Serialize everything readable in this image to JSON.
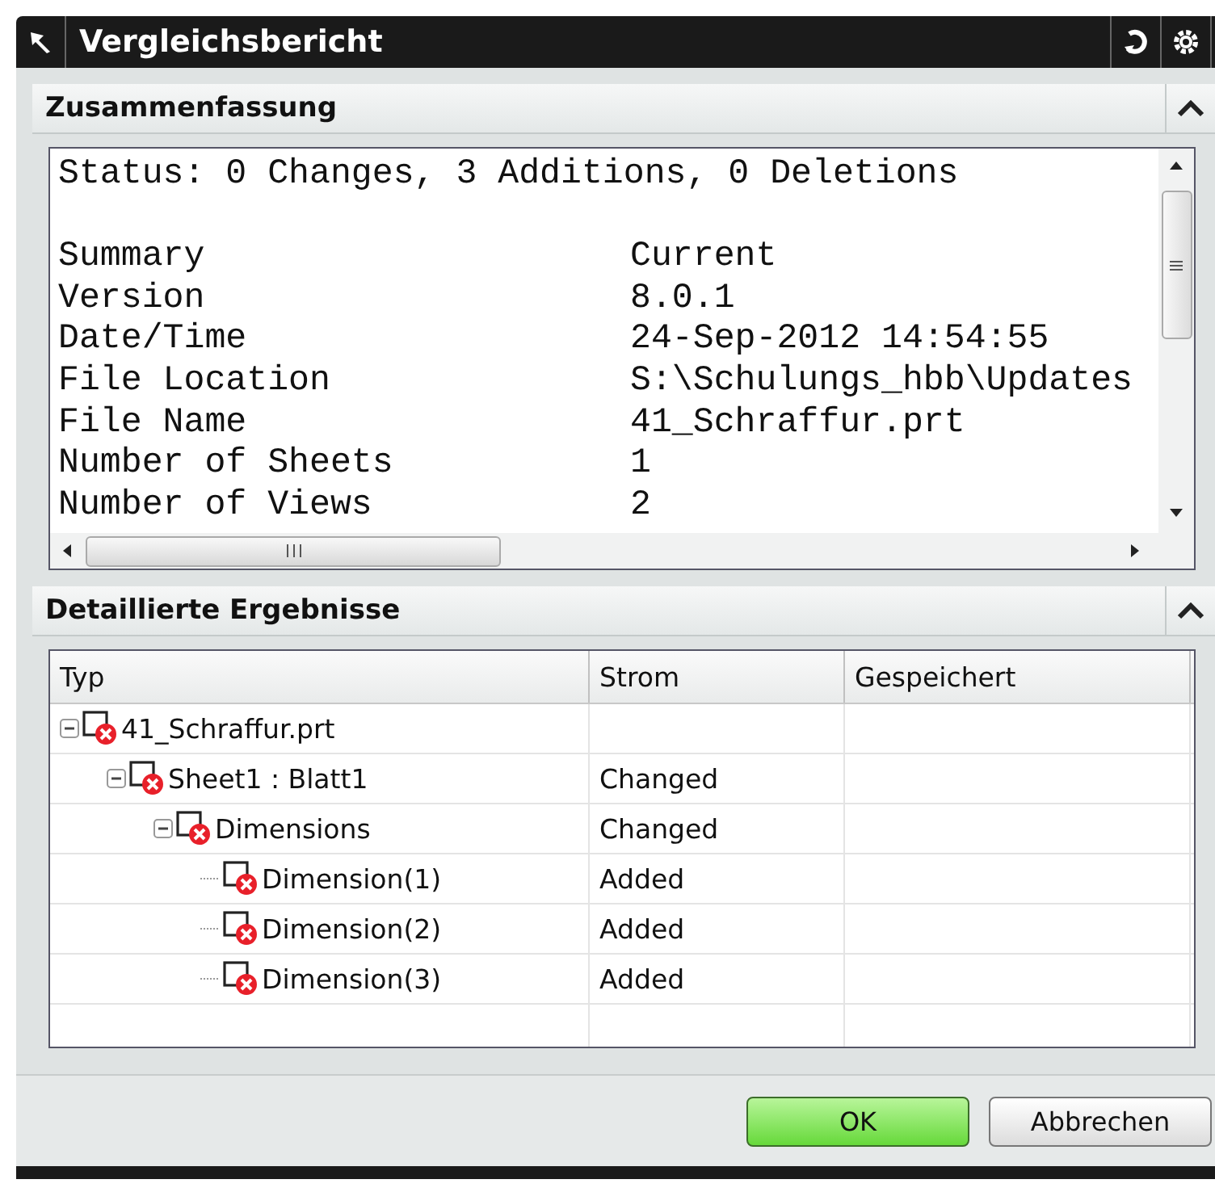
{
  "window": {
    "title": "Vergleichsbericht"
  },
  "summary_section": {
    "title": "Zusammenfassung",
    "expanded": true,
    "status": "Status: 0 Changes, 3 Additions, 0 Deletions",
    "rows": [
      {
        "label": "Summary",
        "value": "Current"
      },
      {
        "label": "Version",
        "value": "8.0.1"
      },
      {
        "label": "Date/Time",
        "value": "24-Sep-2012 14:54:55"
      },
      {
        "label": "File Location",
        "value": "S:\\Schulungs_hbb\\Updates"
      },
      {
        "label": "File Name",
        "value": "41_Schraffur.prt"
      },
      {
        "label": "Number of Sheets",
        "value": "1"
      },
      {
        "label": "Number of Views",
        "value": "2"
      }
    ]
  },
  "details_section": {
    "title": "Detaillierte Ergebnisse",
    "expanded": true,
    "columns": [
      "Typ",
      "Strom",
      "Gespeichert"
    ],
    "tree": [
      {
        "label": "41_Schraffur.prt",
        "expanded": true,
        "children": [
          {
            "label": "Sheet1 : Blatt1",
            "strom": "Changed",
            "expanded": true,
            "children": [
              {
                "label": "Dimensions",
                "strom": "Changed",
                "expanded": true,
                "children": [
                  {
                    "label": "Dimension(1)",
                    "strom": "Added"
                  },
                  {
                    "label": "Dimension(2)",
                    "strom": "Added"
                  },
                  {
                    "label": "Dimension(3)",
                    "strom": "Added"
                  }
                ]
              }
            ]
          }
        ]
      }
    ]
  },
  "buttons": [
    {
      "label": "OK",
      "kind": "primary"
    },
    {
      "label": "Abbrechen",
      "kind": "secondary"
    }
  ]
}
